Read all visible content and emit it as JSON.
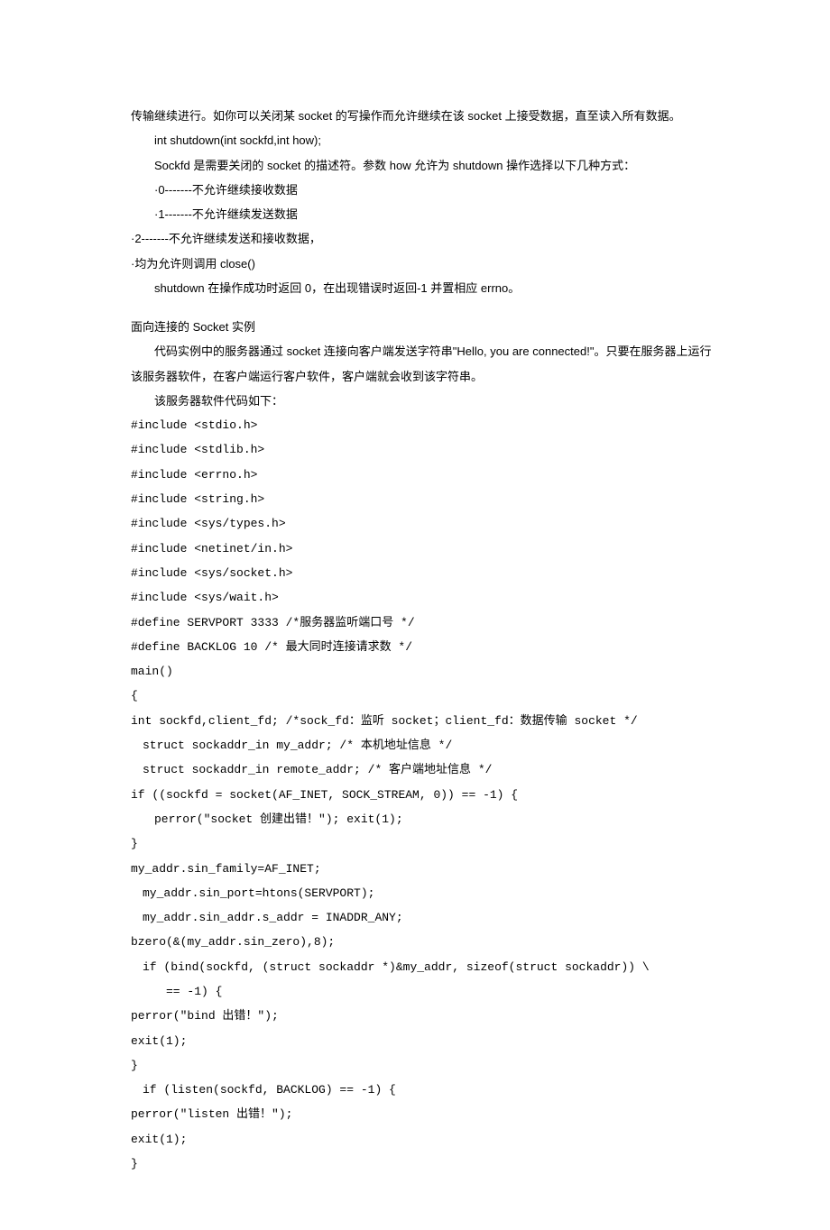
{
  "lines": [
    {
      "cls": "para",
      "key": "l0"
    },
    {
      "cls": "para indent",
      "key": "l1"
    },
    {
      "cls": "para indent",
      "key": "l2"
    },
    {
      "cls": "para indent",
      "key": "l3"
    },
    {
      "cls": "para indent",
      "key": "l4"
    },
    {
      "cls": "para",
      "key": "l5"
    },
    {
      "cls": "para",
      "key": "l6"
    },
    {
      "cls": "para indent",
      "key": "l7"
    },
    {
      "cls": "gap"
    },
    {
      "cls": "para",
      "key": "l8"
    },
    {
      "cls": "para indent",
      "key": "l9"
    },
    {
      "cls": "para indent",
      "key": "l10"
    },
    {
      "cls": "para code",
      "key": "l11"
    },
    {
      "cls": "para code",
      "key": "l12"
    },
    {
      "cls": "para code",
      "key": "l13"
    },
    {
      "cls": "para code",
      "key": "l14"
    },
    {
      "cls": "para code",
      "key": "l15"
    },
    {
      "cls": "para code",
      "key": "l16"
    },
    {
      "cls": "para code",
      "key": "l17"
    },
    {
      "cls": "para code",
      "key": "l18"
    },
    {
      "cls": "para code",
      "key": "l19"
    },
    {
      "cls": "para code",
      "key": "l20"
    },
    {
      "cls": "para code",
      "key": "l21"
    },
    {
      "cls": "para code",
      "key": "l22"
    },
    {
      "cls": "para code",
      "key": "l23"
    },
    {
      "cls": "para code i1",
      "key": "l24"
    },
    {
      "cls": "para code i1",
      "key": "l25"
    },
    {
      "cls": "para code",
      "key": "l26"
    },
    {
      "cls": "para code i2",
      "key": "l27"
    },
    {
      "cls": "para code",
      "key": "l28"
    },
    {
      "cls": "para code",
      "key": "l29"
    },
    {
      "cls": "para code i1",
      "key": "l30"
    },
    {
      "cls": "para code i1",
      "key": "l31"
    },
    {
      "cls": "para code",
      "key": "l32"
    },
    {
      "cls": "para code i1",
      "key": "l33"
    },
    {
      "cls": "para code i3",
      "key": "l34"
    },
    {
      "cls": "para code",
      "key": "l35"
    },
    {
      "cls": "para code",
      "key": "l36"
    },
    {
      "cls": "para code",
      "key": "l37"
    },
    {
      "cls": "para code i1",
      "key": "l38"
    },
    {
      "cls": "para code",
      "key": "l39"
    },
    {
      "cls": "para code",
      "key": "l40"
    },
    {
      "cls": "para code",
      "key": "l41"
    }
  ],
  "text": {
    "l0": "传输继续进行。如你可以关闭某 socket 的写操作而允许继续在该 socket 上接受数据，直至读入所有数据。",
    "l1": "int shutdown(int sockfd,int how);",
    "l2": "Sockfd 是需要关闭的 socket 的描述符。参数 how 允许为 shutdown 操作选择以下几种方式：",
    "l3": "·0-------不允许继续接收数据",
    "l4": "·1-------不允许继续发送数据",
    "l5": "·2-------不允许继续发送和接收数据，",
    "l6": "·均为允许则调用 close()",
    "l7": "shutdown 在操作成功时返回 0，在出现错误时返回-1 并置相应 errno。",
    "l8": "面向连接的 Socket 实例",
    "l9": "代码实例中的服务器通过 socket 连接向客户端发送字符串\"Hello, you are connected!\"。只要在服务器上运行该服务器软件，在客户端运行客户软件，客户端就会收到该字符串。",
    "l10": "该服务器软件代码如下：",
    "l11": "#include <stdio.h>",
    "l12": "#include <stdlib.h>",
    "l13": "#include <errno.h>",
    "l14": "#include <string.h>",
    "l15": "#include <sys/types.h>",
    "l16": "#include <netinet/in.h>",
    "l17": "#include <sys/socket.h>",
    "l18": "#include <sys/wait.h>",
    "l19": "#define SERVPORT 3333 /*服务器监听端口号 */",
    "l20": "#define BACKLOG 10 /* 最大同时连接请求数 */",
    "l21": "main()",
    "l22": "{",
    "l23": "int sockfd,client_fd; /*sock_fd：监听 socket；client_fd：数据传输 socket */",
    "l24": "struct sockaddr_in my_addr; /* 本机地址信息 */",
    "l25": "struct sockaddr_in remote_addr; /* 客户端地址信息 */",
    "l26": "if ((sockfd = socket(AF_INET, SOCK_STREAM, 0)) == -1) {",
    "l27": "perror(\"socket 创建出错！\"); exit(1);",
    "l28": "}",
    "l29": "my_addr.sin_family=AF_INET;",
    "l30": "my_addr.sin_port=htons(SERVPORT);",
    "l31": "my_addr.sin_addr.s_addr = INADDR_ANY;",
    "l32": "bzero(&(my_addr.sin_zero),8);",
    "l33": "if (bind(sockfd, (struct sockaddr *)&my_addr, sizeof(struct sockaddr)) \\",
    "l34": "== -1) {",
    "l35": "perror(\"bind 出错！\");",
    "l36": "exit(1);",
    "l37": "}",
    "l38": "if (listen(sockfd, BACKLOG) == -1) {",
    "l39": "perror(\"listen 出错！\");",
    "l40": "exit(1);",
    "l41": "}"
  }
}
